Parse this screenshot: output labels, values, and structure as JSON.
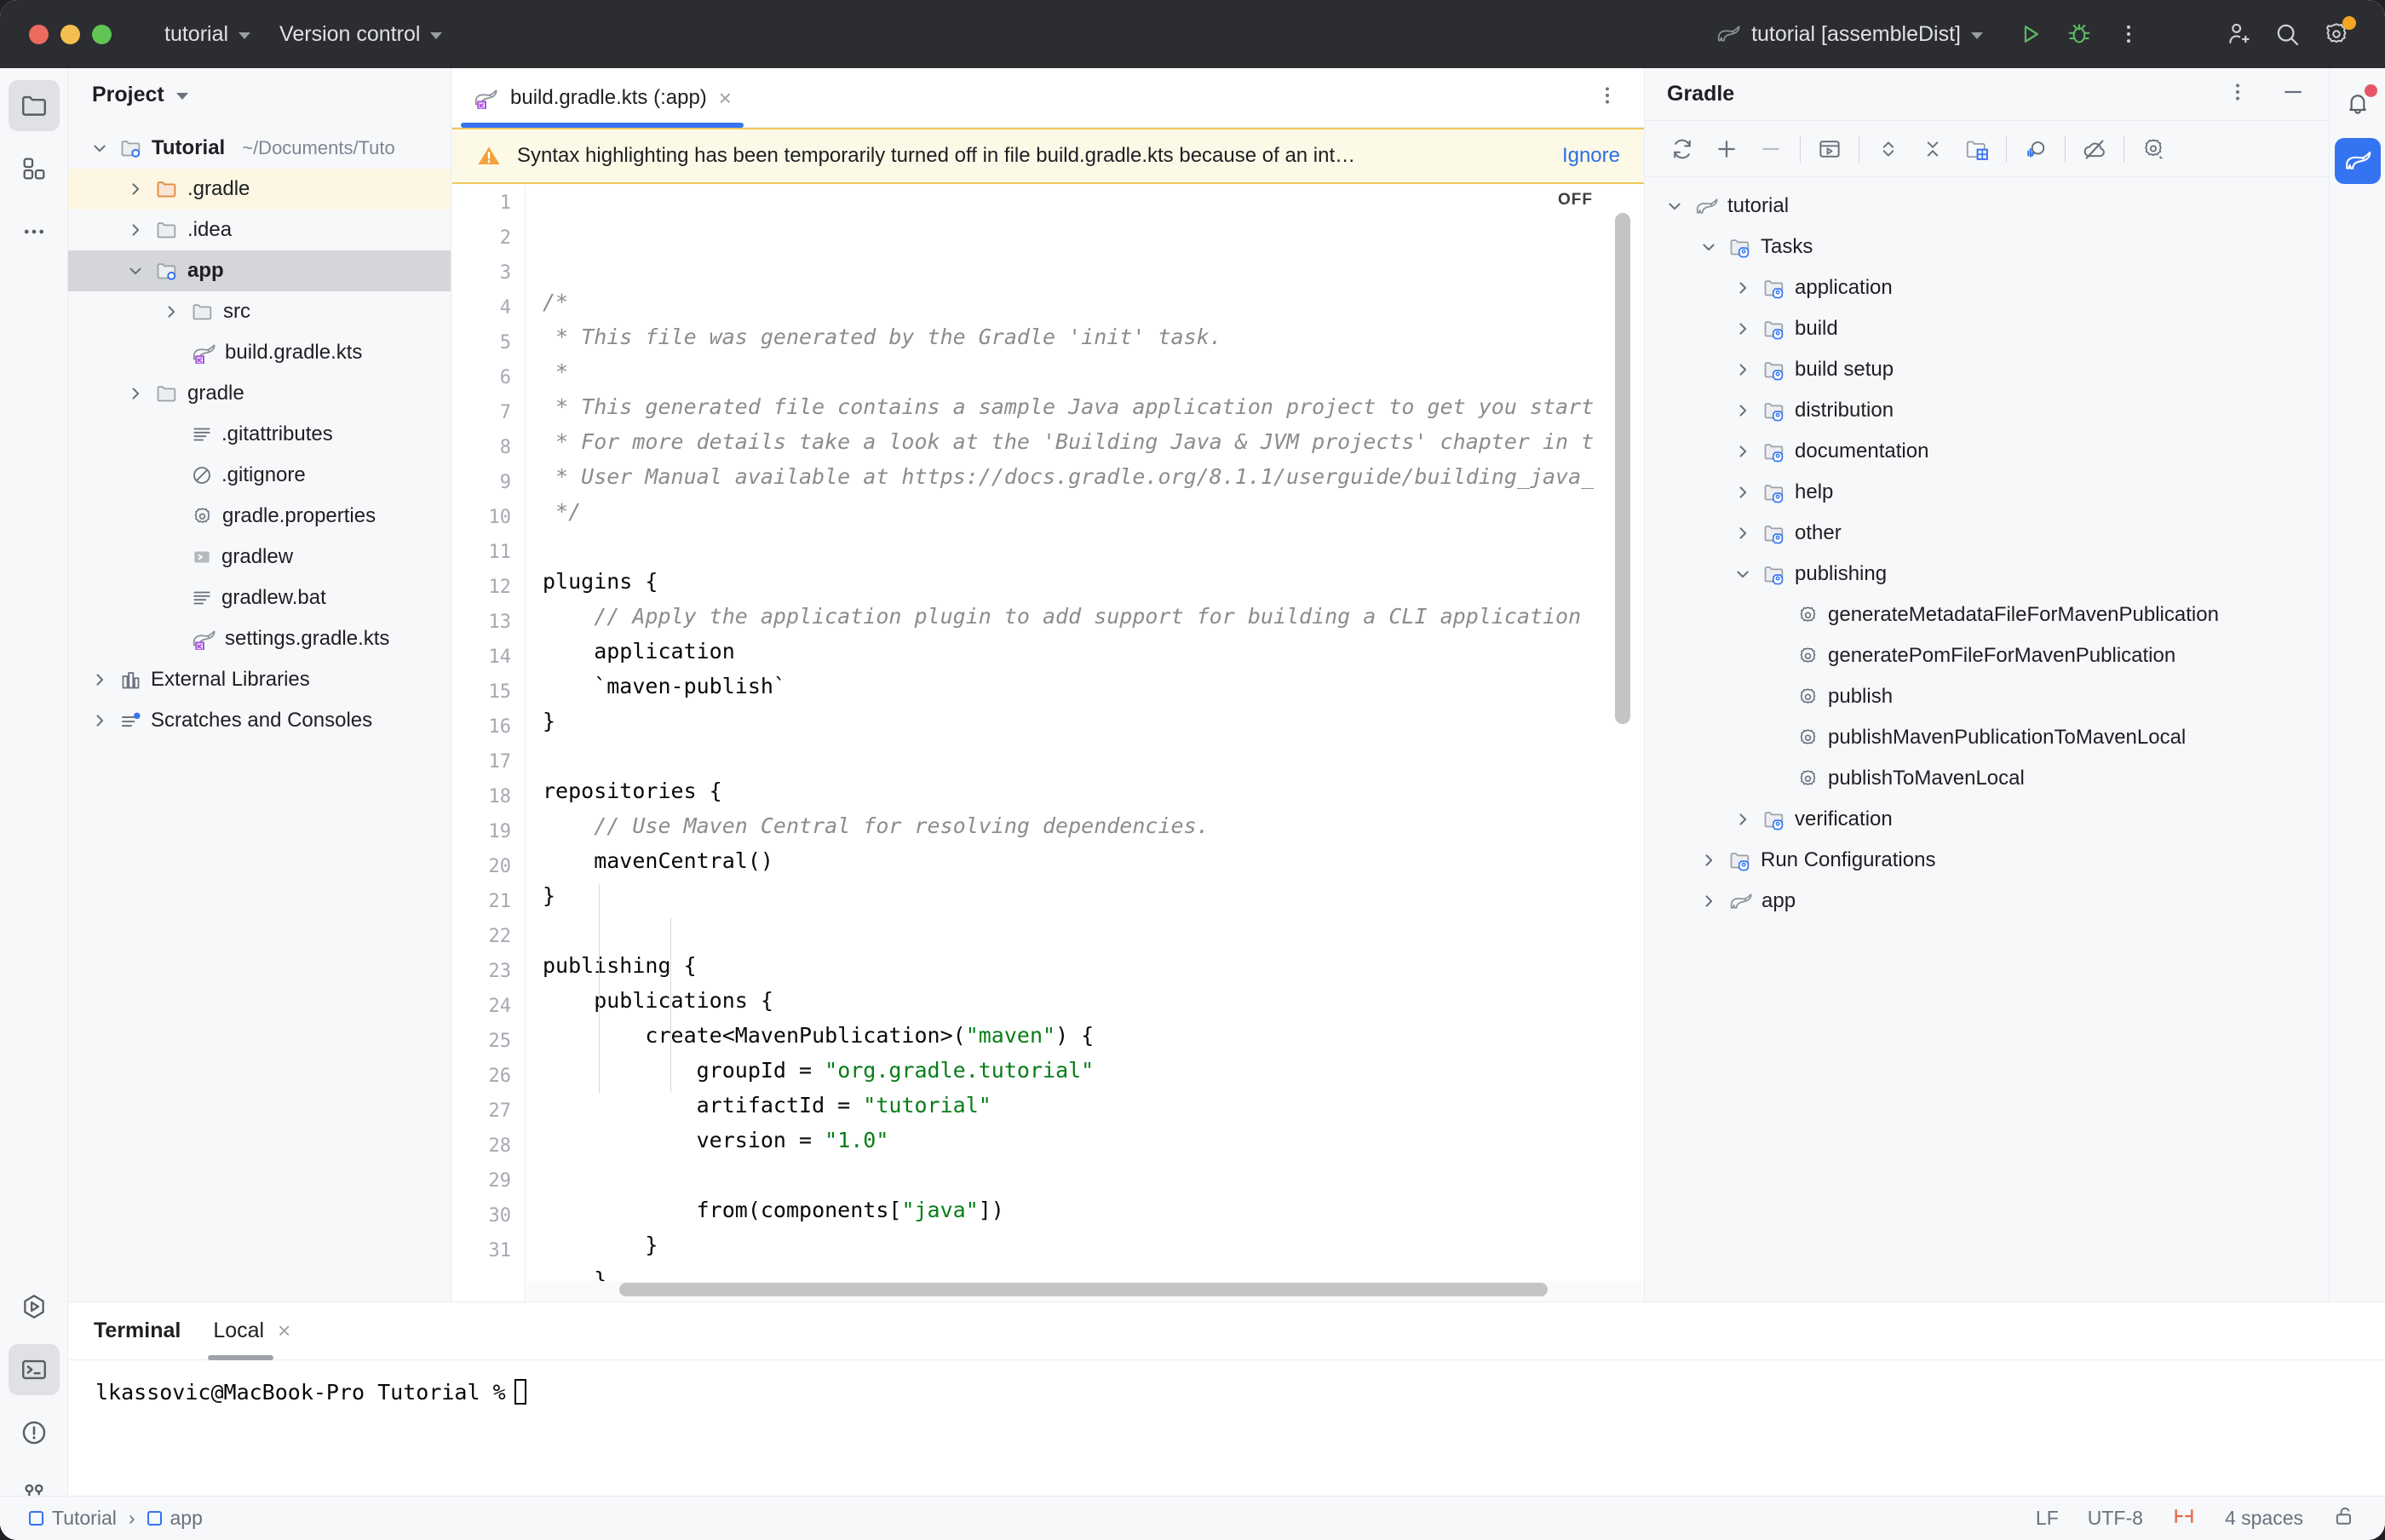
{
  "titlebar": {
    "project_menu": "tutorial",
    "vcs_menu": "Version control",
    "run_config": "tutorial [assembleDist]",
    "icons": {
      "run": "run-icon",
      "debug": "debug-icon",
      "more": "more-options-icon",
      "add_user": "add-user-icon",
      "search": "search-icon",
      "settings": "settings-icon"
    }
  },
  "left_rail": {
    "items": [
      {
        "name": "project-tool-window",
        "icon": "folder-icon",
        "selected": true
      },
      {
        "name": "commit-tool-window",
        "icon": "grid-blocks-icon",
        "selected": false
      },
      {
        "name": "more-tool-windows",
        "icon": "ellipsis-icon",
        "selected": false
      }
    ],
    "bottom_items": [
      {
        "name": "run-tool-window",
        "icon": "run-hexagon-icon",
        "selected": false
      },
      {
        "name": "terminal-tool-window",
        "icon": "terminal-icon",
        "selected": true
      },
      {
        "name": "problems-tool-window",
        "icon": "warning-circle-icon",
        "selected": false
      },
      {
        "name": "version-control-tool-window",
        "icon": "branch-icon",
        "selected": false
      }
    ]
  },
  "project_panel": {
    "title": "Project",
    "tree": [
      {
        "label": "Tutorial",
        "path": "~/Documents/Tuto",
        "indent": 0,
        "arrow": "down",
        "icon": "module-folder-icon",
        "bold": true,
        "state": "normal"
      },
      {
        "label": ".gradle",
        "path": "",
        "indent": 1,
        "arrow": "right",
        "icon": "orange-folder-icon",
        "bold": false,
        "state": "warn"
      },
      {
        "label": ".idea",
        "path": "",
        "indent": 1,
        "arrow": "right",
        "icon": "folder-icon",
        "bold": false,
        "state": "normal"
      },
      {
        "label": "app",
        "path": "",
        "indent": 1,
        "arrow": "down",
        "icon": "module-folder-icon",
        "bold": true,
        "state": "selected"
      },
      {
        "label": "src",
        "path": "",
        "indent": 2,
        "arrow": "right",
        "icon": "folder-icon",
        "bold": false,
        "state": "normal"
      },
      {
        "label": "build.gradle.kts",
        "path": "",
        "indent": 2,
        "arrow": "none",
        "icon": "gradle-kts-icon",
        "bold": false,
        "state": "normal"
      },
      {
        "label": "gradle",
        "path": "",
        "indent": 1,
        "arrow": "right",
        "icon": "folder-icon",
        "bold": false,
        "state": "normal"
      },
      {
        "label": ".gitattributes",
        "path": "",
        "indent": 2,
        "arrow": "none",
        "icon": "text-file-icon",
        "bold": false,
        "state": "normal"
      },
      {
        "label": ".gitignore",
        "path": "",
        "indent": 2,
        "arrow": "none",
        "icon": "gitignore-icon",
        "bold": false,
        "state": "normal"
      },
      {
        "label": "gradle.properties",
        "path": "",
        "indent": 2,
        "arrow": "none",
        "icon": "properties-icon",
        "bold": false,
        "state": "normal"
      },
      {
        "label": "gradlew",
        "path": "",
        "indent": 2,
        "arrow": "none",
        "icon": "shell-script-icon",
        "bold": false,
        "state": "normal"
      },
      {
        "label": "gradlew.bat",
        "path": "",
        "indent": 2,
        "arrow": "none",
        "icon": "text-file-icon",
        "bold": false,
        "state": "normal"
      },
      {
        "label": "settings.gradle.kts",
        "path": "",
        "indent": 2,
        "arrow": "none",
        "icon": "gradle-kts-icon",
        "bold": false,
        "state": "normal"
      },
      {
        "label": "External Libraries",
        "path": "",
        "indent": 0,
        "arrow": "right",
        "icon": "libraries-icon",
        "bold": false,
        "state": "normal"
      },
      {
        "label": "Scratches and Consoles",
        "path": "",
        "indent": 0,
        "arrow": "right",
        "icon": "scratches-icon",
        "bold": false,
        "state": "normal"
      }
    ]
  },
  "editor": {
    "tab": {
      "label": "build.gradle.kts (:app)",
      "icon": "gradle-kts-icon",
      "close": "×"
    },
    "tab_more_icon": "more-options-icon",
    "banner": {
      "icon": "warning-triangle-icon",
      "message": "Syntax highlighting has been temporarily turned off in file build.gradle.kts because of an int…",
      "action": "Ignore"
    },
    "inspection_state": "OFF",
    "line_numbers": [
      1,
      2,
      3,
      4,
      5,
      6,
      7,
      8,
      9,
      10,
      11,
      12,
      13,
      14,
      15,
      16,
      17,
      18,
      19,
      20,
      21,
      22,
      23,
      24,
      25,
      26,
      27,
      28,
      29,
      30,
      31
    ],
    "lines": [
      {
        "n": 1,
        "segments": [
          {
            "t": "/*",
            "c": "cmt"
          }
        ]
      },
      {
        "n": 2,
        "segments": [
          {
            "t": " * This file was generated by the Gradle 'init' task.",
            "c": "cmt"
          }
        ]
      },
      {
        "n": 3,
        "segments": [
          {
            "t": " *",
            "c": "cmt"
          }
        ]
      },
      {
        "n": 4,
        "segments": [
          {
            "t": " * This generated file contains a sample Java application project to get you start",
            "c": "cmt"
          }
        ]
      },
      {
        "n": 5,
        "segments": [
          {
            "t": " * For more details take a look at the 'Building Java & JVM projects' chapter in t",
            "c": "cmt"
          }
        ]
      },
      {
        "n": 6,
        "segments": [
          {
            "t": " * User Manual available at https://docs.gradle.org/8.1.1/userguide/building_java_",
            "c": "cmt"
          }
        ]
      },
      {
        "n": 7,
        "segments": [
          {
            "t": " */",
            "c": "cmt"
          }
        ]
      },
      {
        "n": 8,
        "segments": []
      },
      {
        "n": 9,
        "segments": [
          {
            "t": "plugins {",
            "c": ""
          }
        ]
      },
      {
        "n": 10,
        "segments": [
          {
            "t": "    // Apply the application plugin to add support for building a CLI application",
            "c": "cmt"
          }
        ]
      },
      {
        "n": 11,
        "segments": [
          {
            "t": "    application",
            "c": ""
          }
        ]
      },
      {
        "n": 12,
        "segments": [
          {
            "t": "    `maven-publish`",
            "c": ""
          }
        ]
      },
      {
        "n": 13,
        "segments": [
          {
            "t": "}",
            "c": ""
          }
        ]
      },
      {
        "n": 14,
        "segments": []
      },
      {
        "n": 15,
        "segments": [
          {
            "t": "repositories {",
            "c": ""
          }
        ]
      },
      {
        "n": 16,
        "segments": [
          {
            "t": "    // Use Maven Central for resolving dependencies.",
            "c": "cmt"
          }
        ]
      },
      {
        "n": 17,
        "segments": [
          {
            "t": "    mavenCentral()",
            "c": ""
          }
        ]
      },
      {
        "n": 18,
        "segments": [
          {
            "t": "}",
            "c": ""
          }
        ]
      },
      {
        "n": 19,
        "segments": []
      },
      {
        "n": 20,
        "segments": [
          {
            "t": "publishing {",
            "c": ""
          }
        ]
      },
      {
        "n": 21,
        "segments": [
          {
            "t": "    publications {",
            "c": ""
          }
        ]
      },
      {
        "n": 22,
        "segments": [
          {
            "t": "        create<MavenPublication>(",
            "c": ""
          },
          {
            "t": "\"maven\"",
            "c": "str"
          },
          {
            "t": ") {",
            "c": ""
          }
        ]
      },
      {
        "n": 23,
        "segments": [
          {
            "t": "            groupId = ",
            "c": ""
          },
          {
            "t": "\"org.gradle.tutorial\"",
            "c": "str"
          }
        ]
      },
      {
        "n": 24,
        "segments": [
          {
            "t": "            artifactId = ",
            "c": ""
          },
          {
            "t": "\"tutorial\"",
            "c": "str"
          }
        ]
      },
      {
        "n": 25,
        "segments": [
          {
            "t": "            version = ",
            "c": ""
          },
          {
            "t": "\"1.0\"",
            "c": "str"
          }
        ]
      },
      {
        "n": 26,
        "segments": []
      },
      {
        "n": 27,
        "segments": [
          {
            "t": "            from(components[",
            "c": ""
          },
          {
            "t": "\"java\"",
            "c": "str"
          },
          {
            "t": "])",
            "c": ""
          }
        ]
      },
      {
        "n": 28,
        "segments": [
          {
            "t": "        }",
            "c": ""
          }
        ]
      },
      {
        "n": 29,
        "segments": [
          {
            "t": "    }",
            "c": ""
          }
        ]
      },
      {
        "n": 30,
        "segments": [
          {
            "t": "}",
            "c": ""
          }
        ]
      },
      {
        "n": 31,
        "segments": []
      }
    ]
  },
  "gradle_panel": {
    "title": "Gradle",
    "head_icons": {
      "more": "more-options-icon",
      "minimize": "minimize-icon"
    },
    "toolbar": [
      {
        "name": "reload-gradle-project-icon"
      },
      {
        "name": "link-gradle-project-icon"
      },
      {
        "name": "unlink-gradle-project-icon"
      },
      {
        "name": "run-task-icon"
      },
      {
        "name": "expand-all-icon"
      },
      {
        "name": "collapse-all-icon"
      },
      {
        "name": "show-module-structure-icon"
      },
      {
        "name": "toggle-tasks-icon"
      },
      {
        "name": "offline-mode-icon"
      },
      {
        "name": "gradle-settings-icon"
      }
    ],
    "tree": [
      {
        "label": "tutorial",
        "indent": 0,
        "arrow": "down",
        "icon": "gradle-elephant-icon"
      },
      {
        "label": "Tasks",
        "indent": 1,
        "arrow": "down",
        "icon": "task-folder-icon"
      },
      {
        "label": "application",
        "indent": 2,
        "arrow": "right",
        "icon": "task-folder-icon"
      },
      {
        "label": "build",
        "indent": 2,
        "arrow": "right",
        "icon": "task-folder-icon"
      },
      {
        "label": "build setup",
        "indent": 2,
        "arrow": "right",
        "icon": "task-folder-icon"
      },
      {
        "label": "distribution",
        "indent": 2,
        "arrow": "right",
        "icon": "task-folder-icon"
      },
      {
        "label": "documentation",
        "indent": 2,
        "arrow": "right",
        "icon": "task-folder-icon"
      },
      {
        "label": "help",
        "indent": 2,
        "arrow": "right",
        "icon": "task-folder-icon"
      },
      {
        "label": "other",
        "indent": 2,
        "arrow": "right",
        "icon": "task-folder-icon"
      },
      {
        "label": "publishing",
        "indent": 2,
        "arrow": "down",
        "icon": "task-folder-icon"
      },
      {
        "label": "generateMetadataFileForMavenPublication",
        "indent": 3,
        "arrow": "none",
        "icon": "gear-task-icon"
      },
      {
        "label": "generatePomFileForMavenPublication",
        "indent": 3,
        "arrow": "none",
        "icon": "gear-task-icon"
      },
      {
        "label": "publish",
        "indent": 3,
        "arrow": "none",
        "icon": "gear-task-icon"
      },
      {
        "label": "publishMavenPublicationToMavenLocal",
        "indent": 3,
        "arrow": "none",
        "icon": "gear-task-icon"
      },
      {
        "label": "publishToMavenLocal",
        "indent": 3,
        "arrow": "none",
        "icon": "gear-task-icon"
      },
      {
        "label": "verification",
        "indent": 2,
        "arrow": "right",
        "icon": "task-folder-icon"
      },
      {
        "label": "Run Configurations",
        "indent": 1,
        "arrow": "right",
        "icon": "task-folder-icon"
      },
      {
        "label": "app",
        "indent": 1,
        "arrow": "right",
        "icon": "gradle-elephant-icon"
      }
    ]
  },
  "right_rail": {
    "items": [
      {
        "name": "notifications-icon",
        "badge": true,
        "active": false
      },
      {
        "name": "gradle-tool-window-icon",
        "badge": false,
        "active": true
      }
    ]
  },
  "terminal": {
    "title": "Terminal",
    "tab": "Local",
    "tab_close": "×",
    "prompt": "lkassovic@MacBook-Pro Tutorial %"
  },
  "statusbar": {
    "breadcrumbs": [
      "Tutorial",
      "app"
    ],
    "separator": "›",
    "line_separator": "LF",
    "encoding": "UTF-8",
    "indent_icon": "indent-marker-icon",
    "indent": "4 spaces",
    "lock_icon": "unlocked-icon"
  },
  "colors": {
    "accent": "#3574f0",
    "titlebar_bg": "#2b2d30",
    "panel_bg": "#f7f8fa",
    "editor_bg": "#ffffff",
    "warning_bg": "#fdf9e7",
    "warning_border": "#f0c75e",
    "string_green": "#067d17",
    "comment_gray": "#8c8c8c",
    "link_blue": "#2d6ee3",
    "selected_row": "#d4d6da"
  }
}
